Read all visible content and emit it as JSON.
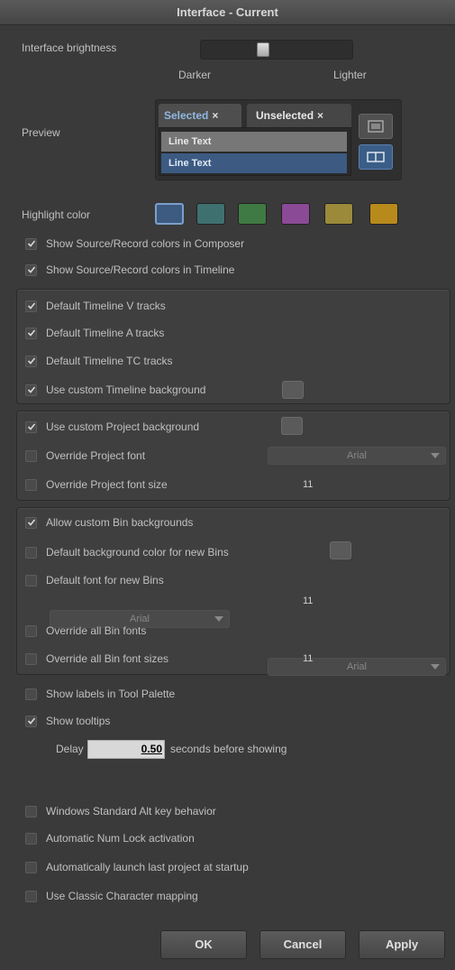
{
  "window": {
    "title": "Interface - Current"
  },
  "brightness": {
    "label": "Interface brightness",
    "darker": "Darker",
    "lighter": "Lighter",
    "level": 0.4
  },
  "preview": {
    "label": "Preview",
    "tab_selected": "Selected",
    "tab_unselected": "Unselected",
    "close_glyph": "×",
    "line1": "Line Text",
    "line2": "Line Text"
  },
  "highlight": {
    "label": "Highlight color",
    "colors": [
      "#3d5a80",
      "#3f7070",
      "#3f7a44",
      "#8a4a96",
      "#9a8a3a",
      "#b88a1c"
    ],
    "selected_index": 0
  },
  "composer": [
    {
      "label": "Show Source/Record colors in Composer",
      "checked": true
    },
    {
      "label": "Show Source/Record colors in Timeline",
      "checked": true
    }
  ],
  "timeline_group": [
    {
      "label": "Default Timeline V tracks",
      "checked": true
    },
    {
      "label": "Default Timeline A tracks",
      "checked": true
    },
    {
      "label": "Default Timeline TC tracks",
      "checked": true
    },
    {
      "label": "Use custom Timeline background",
      "checked": true
    }
  ],
  "project_group": {
    "custom_bg": {
      "label": "Use custom Project background",
      "checked": true
    },
    "override_font": {
      "label": "Override Project font",
      "checked": false,
      "font": "Arial"
    },
    "override_size": {
      "label": "Override Project font size",
      "checked": false,
      "size": "11"
    }
  },
  "bin_group": {
    "allow_bg": {
      "label": "Allow custom Bin backgrounds",
      "checked": true
    },
    "default_bg": {
      "label": "Default background color for new Bins",
      "checked": false
    },
    "default_font": {
      "label": "Default font for new Bins",
      "checked": false,
      "font": "Arial",
      "size": "11"
    },
    "override_fonts": {
      "label": "Override all Bin fonts",
      "checked": false,
      "font": "Arial"
    },
    "override_sizes": {
      "label": "Override all Bin font sizes",
      "checked": false,
      "size": "11"
    }
  },
  "tool_palette": {
    "label": "Show labels in Tool Palette",
    "checked": false
  },
  "tooltips": {
    "label": "Show tooltips",
    "checked": true,
    "delay_label": "Delay",
    "delay_value": "0.50",
    "delay_suffix": "seconds before showing"
  },
  "misc": [
    {
      "label": "Windows Standard Alt key behavior",
      "checked": false
    },
    {
      "label": "Automatic Num Lock activation",
      "checked": false
    },
    {
      "label": "Automatically launch last project at startup",
      "checked": false
    },
    {
      "label": "Use Classic Character mapping",
      "checked": false
    }
  ],
  "buttons": {
    "ok": "OK",
    "cancel": "Cancel",
    "apply": "Apply"
  }
}
